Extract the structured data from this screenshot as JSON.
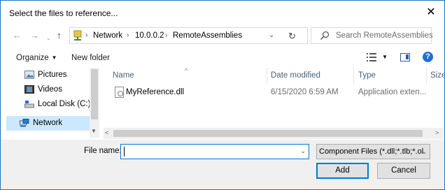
{
  "window": {
    "title": "Select the files to reference..."
  },
  "nav": {
    "back_icon": "arrow-left-icon",
    "forward_icon": "arrow-right-icon",
    "recent_icon": "chevron-down-icon",
    "up_icon": "arrow-up-icon",
    "breadcrumb": [
      "Network",
      "10.0.0.2",
      "RemoteAssemblies"
    ],
    "refresh_icon": "refresh-icon",
    "search_placeholder": "Search RemoteAssemblies"
  },
  "toolbar": {
    "organize_label": "Organize",
    "new_folder_label": "New folder"
  },
  "sidebar": {
    "items": [
      {
        "label": "Pictures",
        "icon": "pictures-folder-icon"
      },
      {
        "label": "Videos",
        "icon": "videos-folder-icon"
      },
      {
        "label": "Local Disk (C:)",
        "icon": "drive-icon"
      },
      {
        "label": "Network",
        "icon": "network-icon",
        "selected": true
      }
    ]
  },
  "columns": [
    "Name",
    "Date modified",
    "Type",
    "Size"
  ],
  "files": [
    {
      "name": "MyReference.dll",
      "date": "6/15/2020 6:59 AM",
      "type": "Application exten...",
      "icon": "dll-file-icon"
    }
  ],
  "footer": {
    "file_name_label": "File name:",
    "file_name_value": "",
    "filter_value": "Component Files (*.dll;*.tlb;*.ol",
    "add_label": "Add",
    "cancel_label": "Cancel"
  },
  "colors": {
    "accent": "#0078d7",
    "selected_bg": "#cce8ff",
    "border": "#1e73be"
  }
}
